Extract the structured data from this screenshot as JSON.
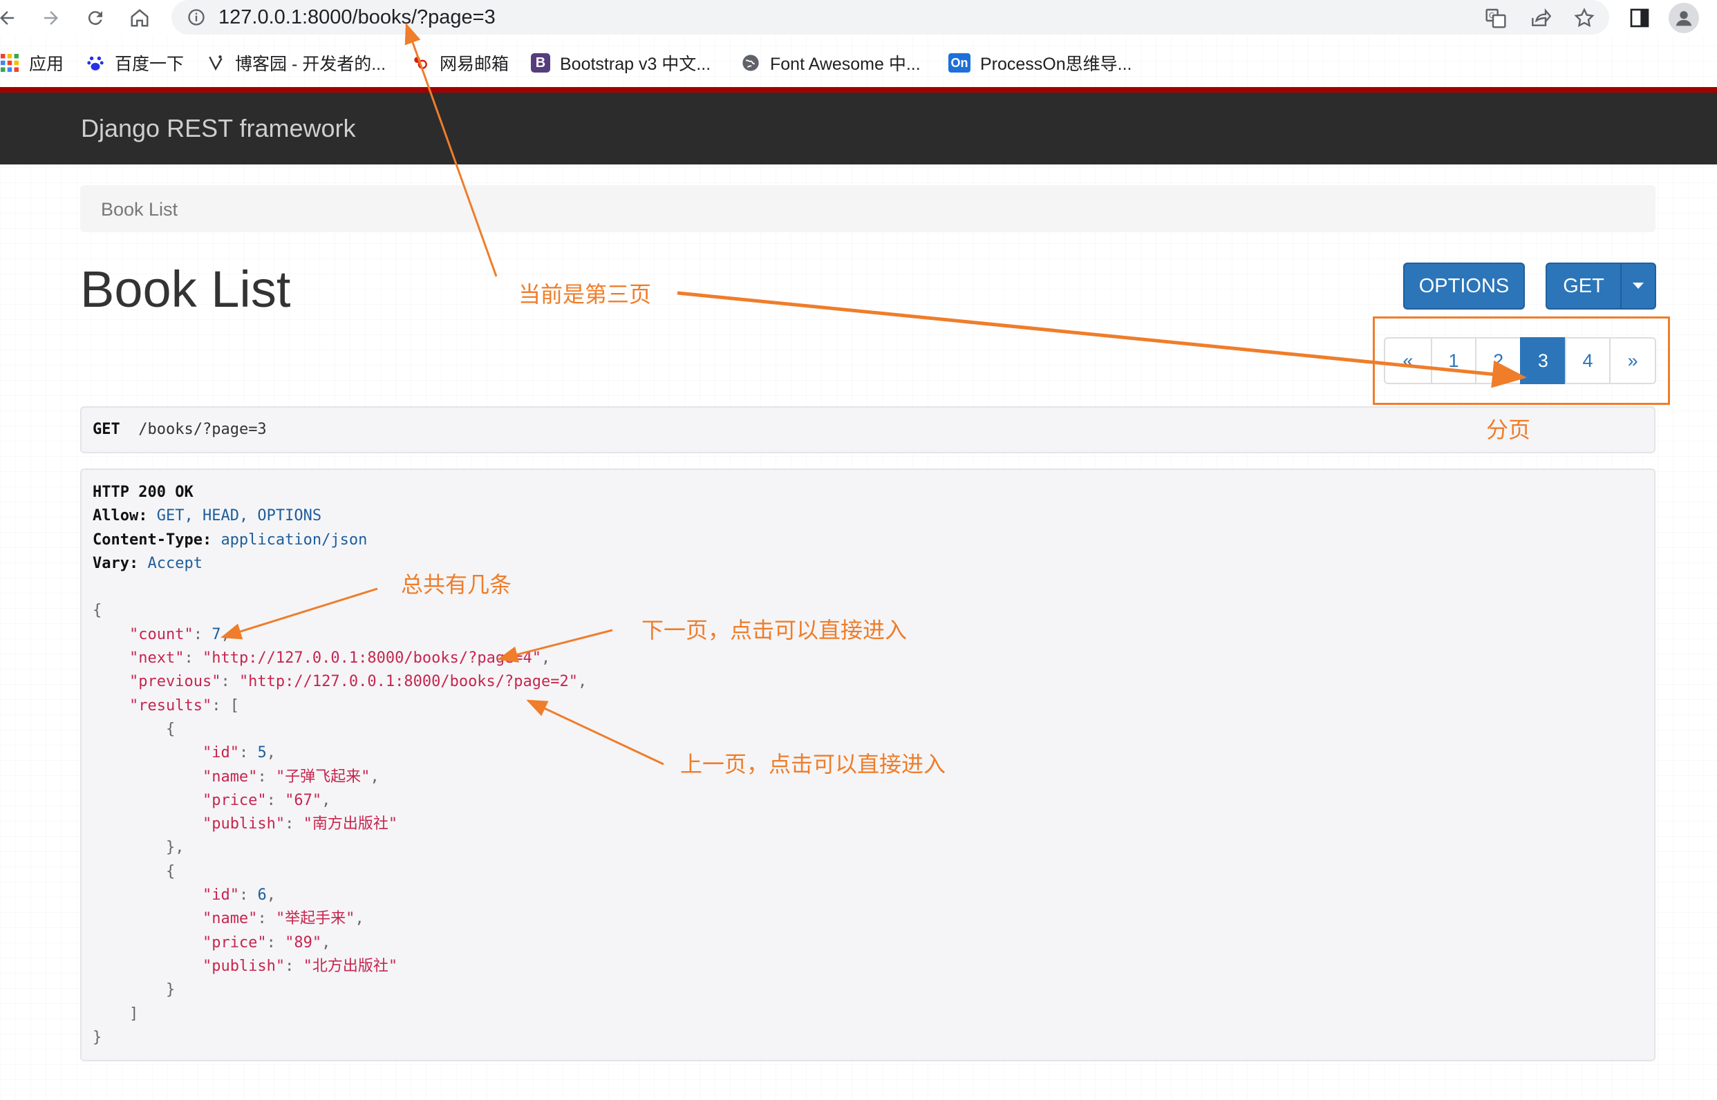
{
  "browser": {
    "url": "127.0.0.1:8000/books/?page=3",
    "bookmarks": [
      {
        "label": "应用"
      },
      {
        "label": "百度一下"
      },
      {
        "label": "博客园 - 开发者的..."
      },
      {
        "label": "网易邮箱"
      },
      {
        "label": "Bootstrap v3 中文..."
      },
      {
        "label": "Font Awesome 中..."
      },
      {
        "label": "ProcessOn思维导..."
      }
    ],
    "bookmark_icons": {
      "b3": "B",
      "processon": "On"
    }
  },
  "navbar": {
    "brand": "Django REST framework"
  },
  "breadcrumb": {
    "label": "Book List"
  },
  "page": {
    "title": "Book List"
  },
  "buttons": {
    "options": "OPTIONS",
    "get": "GET"
  },
  "pagination": {
    "prev": "«",
    "pages": [
      "1",
      "2",
      "3",
      "4"
    ],
    "next": "»",
    "active": "3"
  },
  "request": {
    "method": "GET",
    "path": "/books/?page=3"
  },
  "response": {
    "status": "HTTP 200 OK",
    "headers": [
      {
        "name": "Allow:",
        "value": "GET, HEAD, OPTIONS"
      },
      {
        "name": "Content-Type:",
        "value": "application/json"
      },
      {
        "name": "Vary:",
        "value": "Accept"
      }
    ],
    "count": "7",
    "next": "\"http://127.0.0.1:8000/books/?page=4\"",
    "previous": "\"http://127.0.0.1:8000/books/?page=2\"",
    "results": [
      {
        "id": "5",
        "name": "\"子弹飞起来\"",
        "price": "\"67\"",
        "publish": "\"南方出版社\""
      },
      {
        "id": "6",
        "name": "\"举起手来\"",
        "price": "\"89\"",
        "publish": "\"北方出版社\""
      }
    ],
    "keys": {
      "count": "\"count\"",
      "next": "\"next\"",
      "previous": "\"previous\"",
      "results": "\"results\"",
      "id": "\"id\"",
      "name": "\"name\"",
      "price": "\"price\"",
      "publish": "\"publish\""
    }
  },
  "annotations": {
    "current_page": "当前是第三页",
    "pagination": "分页",
    "total": "总共有几条",
    "next_page": "下一页，点击可以直接进入",
    "prev_page": "上一页，点击可以直接进入"
  },
  "colors": {
    "accent": "#2c75b8",
    "annotation": "#ef7d2a",
    "navbar": "#2c2c2c",
    "navbar_top": "#a30000"
  }
}
